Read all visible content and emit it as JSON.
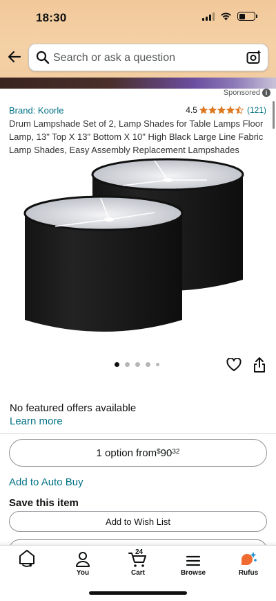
{
  "status_bar": {
    "time": "18:30"
  },
  "search": {
    "placeholder": "Search or ask a question"
  },
  "sponsored_label": "Sponsored",
  "product": {
    "brand": "Brand: Koorle",
    "rating_value": "4.5",
    "rating_count": "(121)",
    "title": "Drum Lampshade Set of 2, Lamp Shades for Table Lamps Floor Lamp, 13\" Top X 13\" Bottom X 10\" High Black Large Line Fabric Lamp Shades, Easy Assembly Replacement Lampshades",
    "image_count": 5,
    "active_image_index": 0
  },
  "offers": {
    "no_offers_text": "No featured offers available",
    "learn_more": "Learn more",
    "option_text": "1 option from ",
    "price_currency": "$",
    "price_whole": "90",
    "price_fraction": "32",
    "auto_buy": "Add to Auto Buy",
    "save_title": "Save this item",
    "wishlist": "Add to Wish List"
  },
  "nav": {
    "items": [
      {
        "label": "",
        "icon": "home-icon"
      },
      {
        "label": "You",
        "icon": "person-icon"
      },
      {
        "label": "Cart",
        "icon": "cart-icon"
      },
      {
        "label": "Browse",
        "icon": "menu-icon"
      },
      {
        "label": "Rufus",
        "icon": "rufus-icon"
      }
    ],
    "cart_count": "24"
  },
  "colors": {
    "header": "#f3cda2",
    "link": "#007185",
    "star": "#de7921",
    "text": "#0f1111"
  }
}
